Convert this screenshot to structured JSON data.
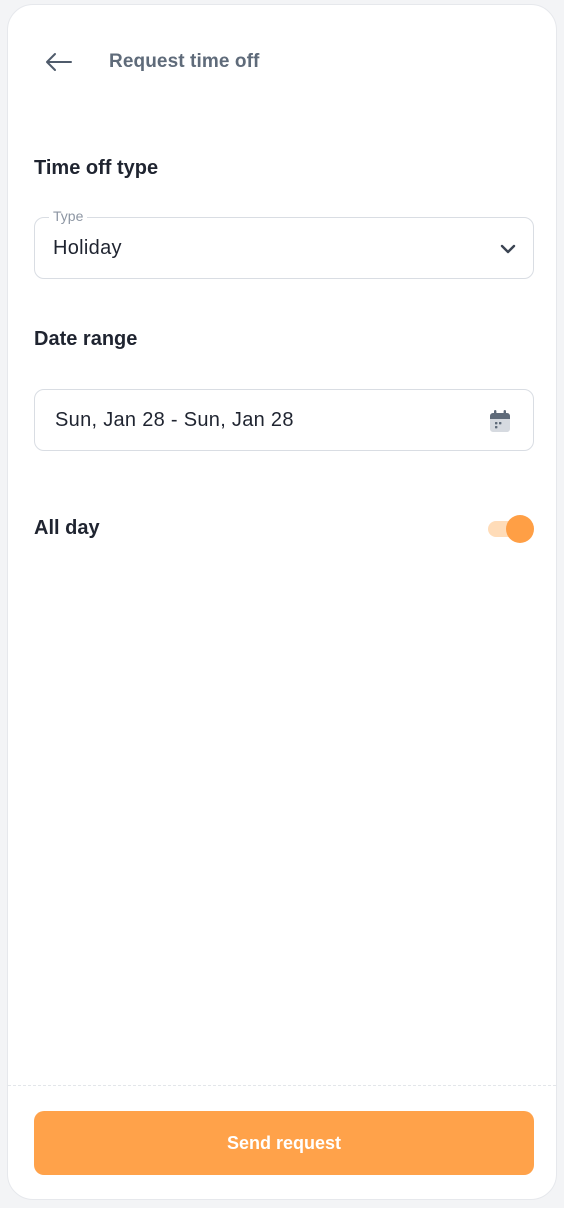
{
  "header": {
    "title": "Request time off",
    "back_icon": "arrow-left-icon"
  },
  "time_off": {
    "section_label": "Time off type",
    "field_legend": "Type",
    "selected_value": "Holiday",
    "dropdown_icon": "chevron-down-icon"
  },
  "date_range": {
    "section_label": "Date range",
    "value": "Sun, Jan 28 - Sun, Jan 28",
    "calendar_icon": "calendar-icon"
  },
  "all_day": {
    "label": "All day",
    "enabled": true
  },
  "footer": {
    "send_label": "Send request"
  },
  "colors": {
    "accent": "#ffa24a",
    "accent_light": "#ffdcb8",
    "title_gray": "#5f6b7a",
    "text_dark": "#1f2430",
    "border": "#d9dde3"
  }
}
